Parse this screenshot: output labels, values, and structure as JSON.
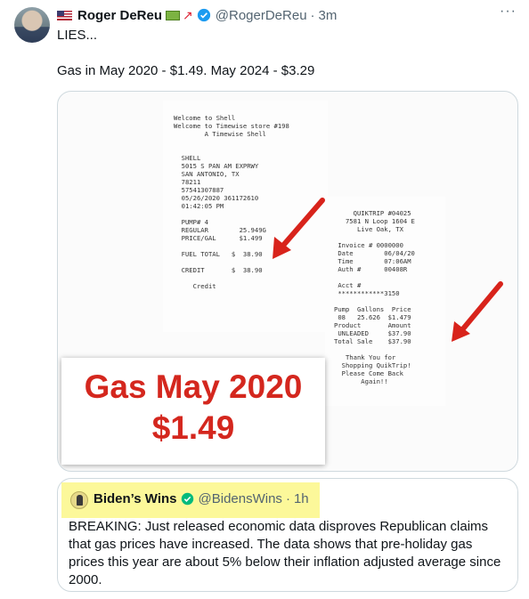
{
  "tweet": {
    "author_name": "Roger DeReu",
    "author_handle": "@RogerDeReu",
    "separator": "·",
    "time": "3m",
    "text_line1": "LIES...",
    "text_line2": "Gas in May 2020 - $1.49. May 2024 - $3.29",
    "more_label": "···"
  },
  "image": {
    "receipt_shell": "Welcome to Shell\nWelcome to Timewise store #198\n        A Timewise Shell\n\n\n  SHELL\n  5015 S PAN AM EXPRWY\n  SAN ANTONIO, TX\n  78211\n  57541307887\n  05/26/2020 361172610\n  01:42:05 PM\n\n  PUMP# 4\n  REGULAR        25.949G\n  PRICE/GAL      $1.499\n\n  FUEL TOTAL   $  38.90\n\n  CREDIT       $  38.90\n\n     Credit",
    "receipt_quiktrip": "     QUIKTRIP #04025\n   7581 N Loop 1604 E\n      Live Oak, TX\n\n Invoice # 0000000\n Date        06/04/20\n Time        07:06AM\n Auth #      00408R\n\n Acct #\n ************3150\n\nPump  Gallons  Price\n 08   25.626  $1.479\nProduct       Amount\n UNLEADED     $37.90\nTotal Sale    $37.90\n\n   Thank You for\n  Shopping QuikTrip!\n  Please Come Back\n       Again!!",
    "callout_line1": "Gas May 2020",
    "callout_line2": "$1.49"
  },
  "quote": {
    "author_name": "Biden’s Wins",
    "author_handle": "@BidensWins",
    "separator": "·",
    "time": "1h",
    "text": "BREAKING: Just released economic data disproves Republican claims that gas prices have increased. The data shows that pre-holiday gas prices this year are about 5% below their inflation adjusted average since 2000."
  },
  "colors": {
    "verified": "#1d9bf0",
    "quote_verified": "#00ba7c",
    "callout_text": "#d4271e",
    "arrow": "#d8231b",
    "highlight": "#fcf89a"
  }
}
